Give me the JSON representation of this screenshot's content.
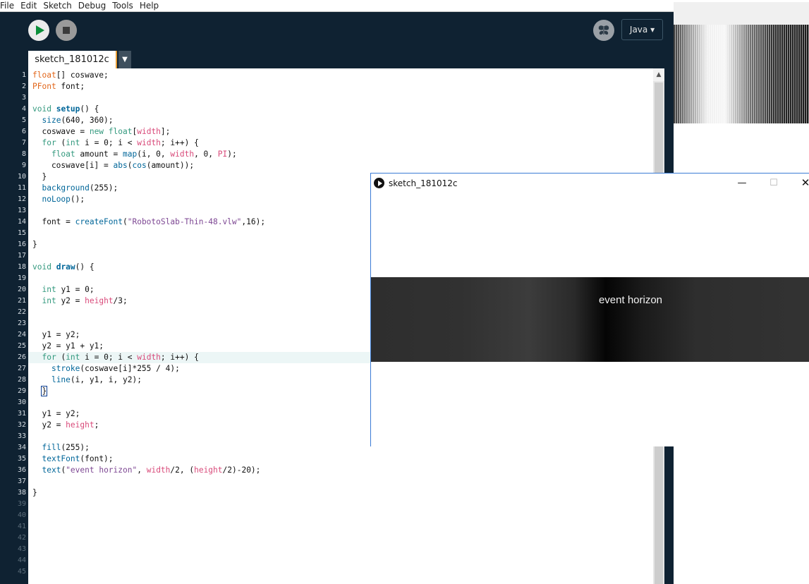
{
  "menu": [
    "File",
    "Edit",
    "Sketch",
    "Debug",
    "Tools",
    "Help"
  ],
  "toolbar": {
    "run_icon": "play-icon",
    "stop_icon": "stop-icon",
    "debug_icon": "butterfly-icon",
    "mode_label": "Java ▾"
  },
  "tabs": {
    "active": "sketch_181012c",
    "menu_arrow": "▼"
  },
  "editor": {
    "highlighted_line": 26,
    "line_numbers": [
      "1",
      "2",
      "3",
      "4",
      "5",
      "6",
      "7",
      "8",
      "9",
      "10",
      "11",
      "12",
      "13",
      "14",
      "15",
      "16",
      "17",
      "18",
      "19",
      "20",
      "21",
      "22",
      "23",
      "24",
      "25",
      "26",
      "27",
      "28",
      "29",
      "30",
      "31",
      "32",
      "33",
      "34",
      "35",
      "36",
      "37",
      "38",
      "39",
      "40",
      "41",
      "42",
      "43",
      "44",
      "45"
    ],
    "lines": [
      "float[] coswave;",
      "PFont font;",
      "",
      "void setup() {",
      "  size(640, 360);",
      "  coswave = new float[width];",
      "  for (int i = 0; i < width; i++) {",
      "    float amount = map(i, 0, width, 0, PI);",
      "    coswave[i] = abs(cos(amount));",
      "  }",
      "  background(255);",
      "  noLoop();",
      "",
      "  font = createFont(\"RobotoSlab-Thin-48.vlw\",16);",
      "",
      "}",
      "",
      "void draw() {",
      "",
      "  int y1 = 0;",
      "  int y2 = height/3;",
      "",
      "",
      "  y1 = y2;",
      "  y2 = y1 + y1;",
      "  for (int i = 0; i < width; i++) {",
      "    stroke(coswave[i]*255 / 4);",
      "    line(i, y1, i, y2);",
      "  }",
      "",
      "  y1 = y2;",
      "  y2 = height;",
      "",
      "  fill(255);",
      "  textFont(font);",
      "  text(\"event horizon\", width/2, (height/2)-20);",
      "",
      "}"
    ]
  },
  "sketch_window": {
    "title": "sketch_181012c",
    "min_glyph": "—",
    "max_glyph": "☐",
    "close_glyph": "✕",
    "canvas_text": "event horizon"
  },
  "colors": {
    "ide_bg": "#0f2232",
    "keyword": "#33997e",
    "type": "#e2661a",
    "function": "#006699",
    "string": "#7d4793",
    "accent_tab": "#e69d36",
    "window_border": "#3a7bd5"
  }
}
